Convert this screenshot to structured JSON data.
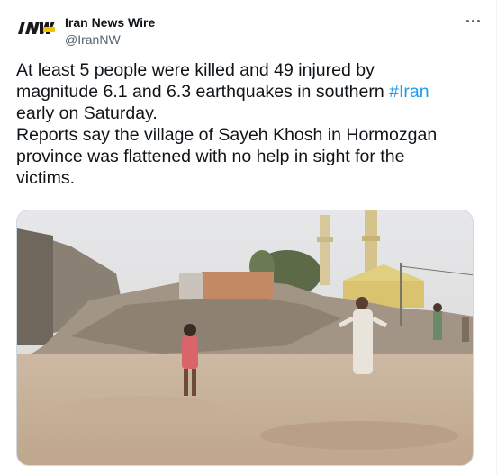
{
  "account": {
    "display_name": "Iran News Wire",
    "handle": "@IranNW",
    "avatar_text": "INW"
  },
  "tweet": {
    "line1_prefix": "At least 5 people were killed and 49 injured by",
    "line2_prefix": "magnitude 6.1 and 6.3 earthquakes in southern ",
    "hashtag": "#Iran",
    "line3": "early on Saturday.",
    "para2_line1": "Reports say the village of Sayeh Khosh in Hormozgan",
    "para2_line2": "province was flattened with no help in sight for the",
    "para2_line3": "victims."
  },
  "icons": {
    "more": "more-options-icon"
  },
  "colors": {
    "text": "#0f1419",
    "secondary": "#536471",
    "link": "#1d9bf0",
    "border": "#cfd9de"
  }
}
